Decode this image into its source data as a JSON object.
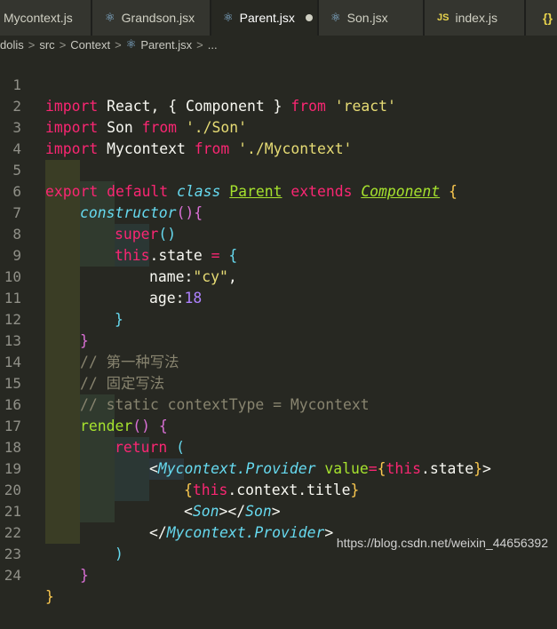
{
  "tabs": [
    {
      "label": "Mycontext.js",
      "icon": "js-file-icon",
      "active": false
    },
    {
      "label": "Grandson.jsx",
      "icon": "react-icon",
      "active": false
    },
    {
      "label": "Parent.jsx",
      "icon": "react-icon",
      "active": true,
      "modified": true
    },
    {
      "label": "Son.jsx",
      "icon": "react-icon",
      "active": false
    },
    {
      "label": "index.js",
      "icon": "js-file-icon",
      "active": false
    },
    {
      "label": "{}",
      "icon": "json-file-icon",
      "active": false
    }
  ],
  "js_badge": "JS",
  "breadcrumb": [
    "dolis",
    "src",
    "Context",
    "Parent.jsx",
    "..."
  ],
  "line_numbers": [
    "1",
    "2",
    "3",
    "4",
    "5",
    "6",
    "7",
    "8",
    "9",
    "10",
    "11",
    "12",
    "13",
    "14",
    "15",
    "16",
    "17",
    "18",
    "19",
    "20",
    "21",
    "22",
    "23",
    "24"
  ],
  "code": {
    "import": "import",
    "from": "from",
    "react_mod": "'react'",
    "son_mod": "'./Son'",
    "ctx_mod": "'./Mycontext'",
    "react_name": "React",
    "component_name": "Component",
    "son_name": "Son",
    "mycontext_name": "Mycontext",
    "export": "export",
    "default": "default",
    "class": "class",
    "parent": "Parent",
    "extends": "extends",
    "constructor": "constructor",
    "super": "super",
    "this": "this",
    "state_prop": ".state",
    "name_key": "name:",
    "name_val": "\"cy\"",
    "age_key": "age:",
    "age_val": "18",
    "comment1": "// 第一种写法",
    "comment2": "// 固定写法",
    "comment3": "// static contextType = Mycontext",
    "render": "render",
    "return": "return",
    "provider_name": "Mycontext.Provider",
    "value_attr": "value",
    "context_title": ".context.title"
  },
  "watermark": "https://blog.csdn.net/weixin_44656392"
}
